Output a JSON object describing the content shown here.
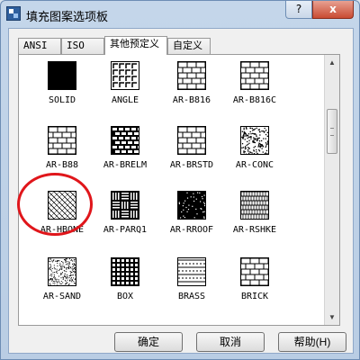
{
  "window": {
    "title": "填充图案选项板",
    "help_button": "?",
    "close_button": "x"
  },
  "tabs": [
    {
      "label": "ANSI",
      "active": false
    },
    {
      "label": "ISO",
      "active": false
    },
    {
      "label": "其他预定义",
      "active": true
    },
    {
      "label": "自定义",
      "active": false
    }
  ],
  "patterns": [
    {
      "name": "SOLID",
      "icon": "solid-pattern-icon"
    },
    {
      "name": "ANGLE",
      "icon": "angle-pattern-icon"
    },
    {
      "name": "AR-B816",
      "icon": "brick-pattern-icon"
    },
    {
      "name": "AR-B816C",
      "icon": "brick-pattern-icon"
    },
    {
      "name": "AR-B88",
      "icon": "brick-pattern-icon"
    },
    {
      "name": "AR-BRELM",
      "icon": "brick-elm-pattern-icon"
    },
    {
      "name": "AR-BRSTD",
      "icon": "brick-pattern-icon"
    },
    {
      "name": "AR-CONC",
      "icon": "concrete-pattern-icon"
    },
    {
      "name": "AR-HBONE",
      "icon": "herringbone-pattern-icon",
      "highlighted": true
    },
    {
      "name": "AR-PARQ1",
      "icon": "parquet-pattern-icon"
    },
    {
      "name": "AR-RROOF",
      "icon": "roof-pattern-icon"
    },
    {
      "name": "AR-RSHKE",
      "icon": "shake-pattern-icon"
    },
    {
      "name": "AR-SAND",
      "icon": "sand-pattern-icon"
    },
    {
      "name": "BOX",
      "icon": "box-pattern-icon"
    },
    {
      "name": "BRASS",
      "icon": "brass-pattern-icon"
    },
    {
      "name": "BRICK",
      "icon": "brick-pattern-icon"
    }
  ],
  "buttons": {
    "ok": "确定",
    "cancel": "取消",
    "help": "帮助(H)"
  },
  "colors": {
    "annotation": "#e0161b",
    "pattern_ink": "#000000"
  }
}
